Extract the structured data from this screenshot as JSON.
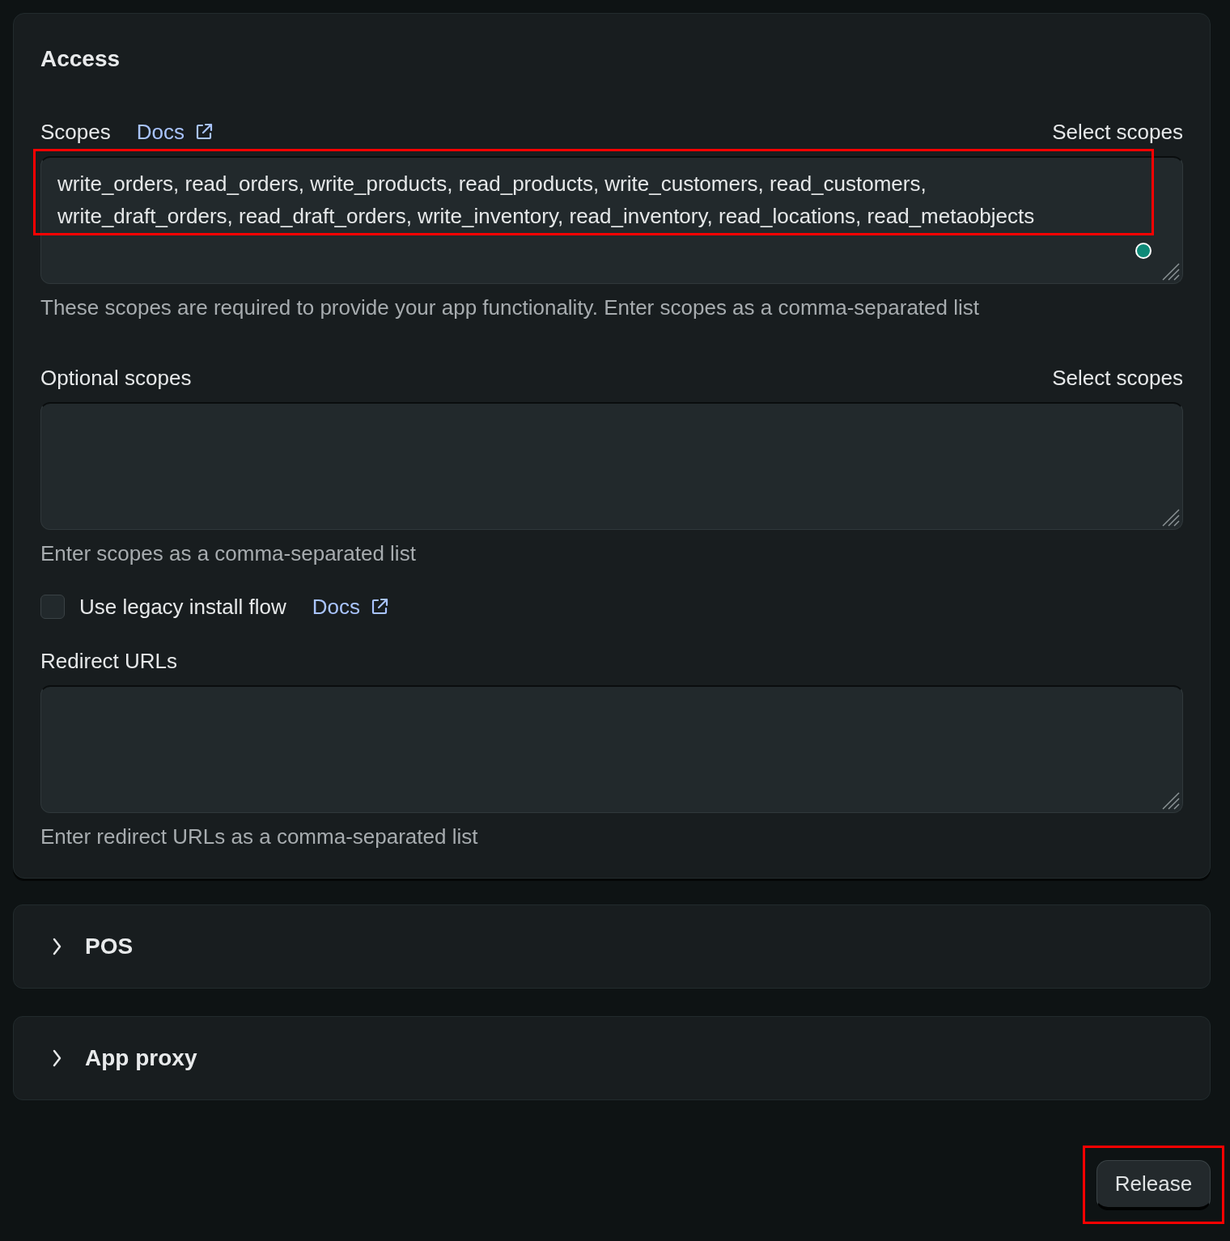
{
  "access": {
    "title": "Access",
    "scopes": {
      "label": "Scopes",
      "docs_link": "Docs",
      "select_link": "Select scopes",
      "value_lines": [
        "write_orders, read_orders, write_products, read_products, write_customers, read_customers,",
        "write_draft_orders, read_draft_orders, write_inventory, read_inventory, read_locations, read_metaobjects"
      ],
      "help": "These scopes are required to provide your app functionality. Enter scopes as a comma-separated list",
      "highlighted": true
    },
    "optional_scopes": {
      "label": "Optional scopes",
      "select_link": "Select scopes",
      "help": "Enter scopes as a comma-separated list"
    },
    "legacy_install": {
      "label": "Use legacy install flow",
      "checked": false,
      "docs_link": "Docs"
    },
    "redirect_urls": {
      "label": "Redirect URLs",
      "help": "Enter redirect URLs as a comma-separated list"
    }
  },
  "sections": [
    {
      "title": "POS",
      "expanded": false
    },
    {
      "title": "App proxy",
      "expanded": false
    }
  ],
  "release_button": {
    "label": "Release",
    "highlighted": true
  }
}
